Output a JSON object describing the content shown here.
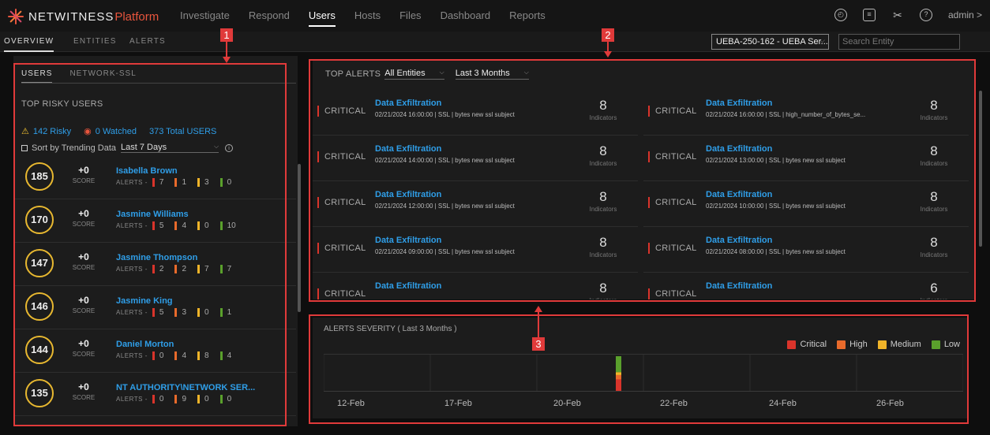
{
  "nav": {
    "brand_a": "NETWITNESS",
    "brand_b": "Platform",
    "items": [
      "Investigate",
      "Respond",
      "Users",
      "Hosts",
      "Files",
      "Dashboard",
      "Reports"
    ],
    "active": "Users",
    "icons": [
      "clock-icon",
      "settings-icon",
      "tools-icon",
      "help-icon"
    ],
    "user": "admin >"
  },
  "subnav": {
    "tabs": [
      "OVERVIEW",
      "ENTITIES",
      "ALERTS"
    ],
    "active": "OVERVIEW",
    "entity_select": "UEBA-250-162 - UEBA Ser...",
    "search_placeholder": "Search Entity"
  },
  "left": {
    "tabs": [
      "USERS",
      "NETWORK-SSL"
    ],
    "section_title": "TOP RISKY USERS",
    "risky": "142 Risky",
    "watched": "0 Watched",
    "total": "373 Total USERS",
    "sort_label": "Sort by Trending Data",
    "period": "Last 7 Days",
    "score_label": "SCORE",
    "alerts_label": "ALERTS -",
    "users": [
      {
        "score": "185",
        "delta": "+0",
        "name": "Isabella Brown",
        "alerts": [
          "7",
          "1",
          "3",
          "0"
        ]
      },
      {
        "score": "170",
        "delta": "+0",
        "name": "Jasmine Williams",
        "alerts": [
          "5",
          "4",
          "0",
          "10"
        ]
      },
      {
        "score": "147",
        "delta": "+0",
        "name": "Jasmine Thompson",
        "alerts": [
          "2",
          "2",
          "7",
          "7"
        ]
      },
      {
        "score": "146",
        "delta": "+0",
        "name": "Jasmine King",
        "alerts": [
          "5",
          "3",
          "0",
          "1"
        ]
      },
      {
        "score": "144",
        "delta": "+0",
        "name": "Daniel Morton",
        "alerts": [
          "0",
          "4",
          "8",
          "4"
        ]
      },
      {
        "score": "135",
        "delta": "+0",
        "name": "NT AUTHORITY\\NETWORK SER...",
        "alerts": [
          "0",
          "9",
          "0",
          "0"
        ]
      }
    ]
  },
  "top_alerts": {
    "title": "TOP ALERTS",
    "filter_entities": "All Entities",
    "filter_period": "Last 3 Months",
    "indicator_label": "Indicators",
    "rows": [
      {
        "severity": "CRITICAL",
        "title": "Data Exfiltration",
        "meta": "02/21/2024 16:00:00  |  SSL  |  bytes new ssl subject",
        "count": "8"
      },
      {
        "severity": "CRITICAL",
        "title": "Data Exfiltration",
        "meta": "02/21/2024 16:00:00  |  SSL  |  high_number_of_bytes_se...",
        "count": "8"
      },
      {
        "severity": "CRITICAL",
        "title": "Data Exfiltration",
        "meta": "02/21/2024 14:00:00  |  SSL  |  bytes new ssl subject",
        "count": "8"
      },
      {
        "severity": "CRITICAL",
        "title": "Data Exfiltration",
        "meta": "02/21/2024 13:00:00  |  SSL  |  bytes new ssl subject",
        "count": "8"
      },
      {
        "severity": "CRITICAL",
        "title": "Data Exfiltration",
        "meta": "02/21/2024 12:00:00  |  SSL  |  bytes new ssl subject",
        "count": "8"
      },
      {
        "severity": "CRITICAL",
        "title": "Data Exfiltration",
        "meta": "02/21/2024 10:00:00  |  SSL  |  bytes new ssl subject",
        "count": "8"
      },
      {
        "severity": "CRITICAL",
        "title": "Data Exfiltration",
        "meta": "02/21/2024 09:00:00  |  SSL  |  bytes new ssl subject",
        "count": "8"
      },
      {
        "severity": "CRITICAL",
        "title": "Data Exfiltration",
        "meta": "02/21/2024 08:00:00  |  SSL  |  bytes new ssl subject",
        "count": "8"
      },
      {
        "severity": "CRITICAL",
        "title": "Data Exfiltration",
        "meta": "",
        "count": "8"
      },
      {
        "severity": "CRITICAL",
        "title": "Data Exfiltration",
        "meta": "",
        "count": "6"
      }
    ]
  },
  "severity": {
    "title": "ALERTS SEVERITY ( Last 3 Months )",
    "legend": [
      {
        "name": "Critical",
        "color": "#d9342b"
      },
      {
        "name": "High",
        "color": "#e86a2b"
      },
      {
        "name": "Medium",
        "color": "#f0b429"
      },
      {
        "name": "Low",
        "color": "#5aa02c"
      }
    ],
    "ticks": [
      "12-Feb",
      "17-Feb",
      "20-Feb",
      "22-Feb",
      "24-Feb",
      "26-Feb"
    ]
  },
  "chart_data": {
    "type": "bar",
    "title": "ALERTS SEVERITY ( Last 3 Months )",
    "x_ticks": [
      "12-Feb",
      "17-Feb",
      "20-Feb",
      "22-Feb",
      "24-Feb",
      "26-Feb"
    ],
    "stacked": true,
    "series": [
      {
        "name": "Critical",
        "points": [
          {
            "x": "21-Feb",
            "y": 9
          }
        ]
      },
      {
        "name": "High",
        "points": [
          {
            "x": "21-Feb",
            "y": 3
          }
        ]
      },
      {
        "name": "Medium",
        "points": [
          {
            "x": "21-Feb",
            "y": 2
          }
        ]
      },
      {
        "name": "Low",
        "points": [
          {
            "x": "21-Feb",
            "y": 11
          }
        ]
      }
    ]
  },
  "annotations": [
    "1",
    "2",
    "3"
  ]
}
